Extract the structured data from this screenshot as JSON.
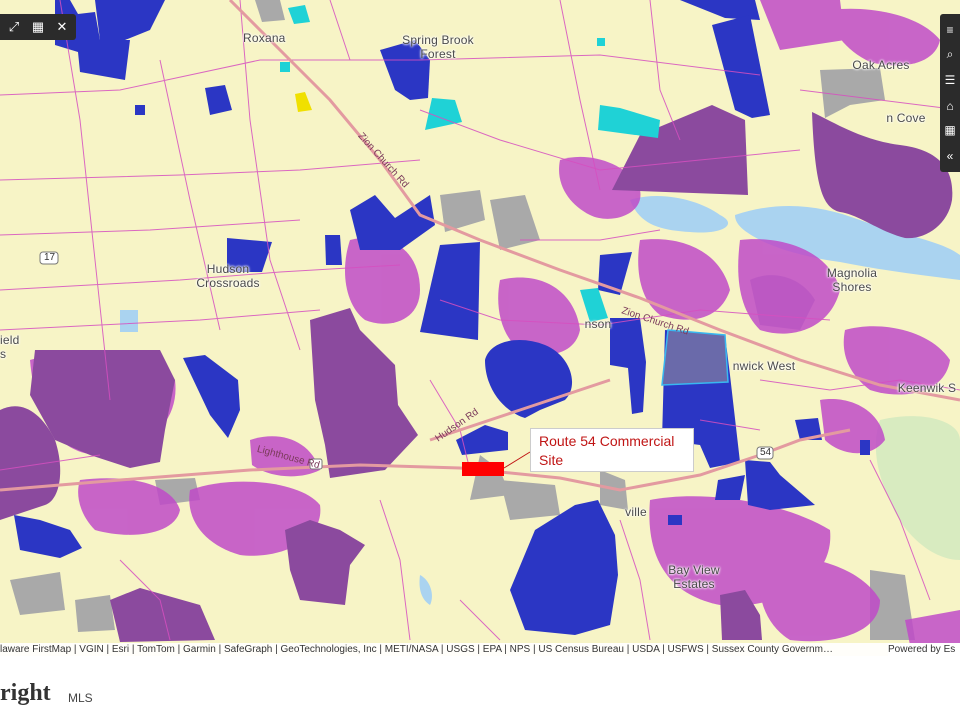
{
  "map": {
    "callout_title": "Route 54 Commercial Site",
    "places": [
      {
        "id": "roxana",
        "label": "Roxana"
      },
      {
        "id": "spring-brook",
        "label": "Spring Brook\nForest"
      },
      {
        "id": "oak-acres",
        "label": "Oak Acres"
      },
      {
        "id": "cove",
        "label": "n Cove"
      },
      {
        "id": "hudson",
        "label": "Hudson\nCrossroads"
      },
      {
        "id": "magnolia",
        "label": "Magnolia\nShores"
      },
      {
        "id": "fenwick-west",
        "label": "nwick West"
      },
      {
        "id": "keenwik",
        "label": "Keenwik S"
      },
      {
        "id": "field",
        "label": "ield\ns"
      },
      {
        "id": "bay-view",
        "label": "Bay View\nEstates"
      },
      {
        "id": "ville",
        "label": "ville"
      },
      {
        "id": "nson",
        "label": "nson"
      }
    ],
    "roads": [
      {
        "id": "zion-church-rd-n",
        "label": "Zion Church Rd"
      },
      {
        "id": "zion-church-rd-e",
        "label": "Zion Church Rd"
      },
      {
        "id": "hudson-rd",
        "label": "Hudson Rd"
      },
      {
        "id": "lighthouse-rd",
        "label": "Lighthouse Rd"
      },
      {
        "id": "route-17",
        "label": "17"
      },
      {
        "id": "route-54",
        "label": "54"
      }
    ],
    "colors": {
      "base": "#f7f4c6",
      "road": "#d64fc0",
      "blue_parcel": "#2b36c4",
      "purple_parcel": "#8b4a9e",
      "magenta_residential": "#c04bc8",
      "gray_parcel": "#a9a9a9",
      "cyan_parcel": "#1fd2d6",
      "water": "#aad3f0",
      "highlight": "#ff0000",
      "main_road": "#e39aa0"
    }
  },
  "toolbar_left": {
    "items": [
      "expand-icon",
      "select-icon",
      "close-icon"
    ],
    "close_label": "✕"
  },
  "toolbar_right": {
    "items": [
      "layers-icon",
      "search-icon",
      "list-icon",
      "home-icon",
      "grid-icon",
      "collapse-icon"
    ]
  },
  "attribution": {
    "text": "laware FirstMap | VGIN | Esri | TomTom | Garmin | SafeGraph | GeoTechnologies, Inc | METI/NASA | USGS | EPA | NPS | US Census Bureau | USDA | USFWS | Sussex County Governm…",
    "powered": "Powered by Es"
  },
  "footer": {
    "logo_text": "right",
    "logo_suffix": "MLS"
  }
}
